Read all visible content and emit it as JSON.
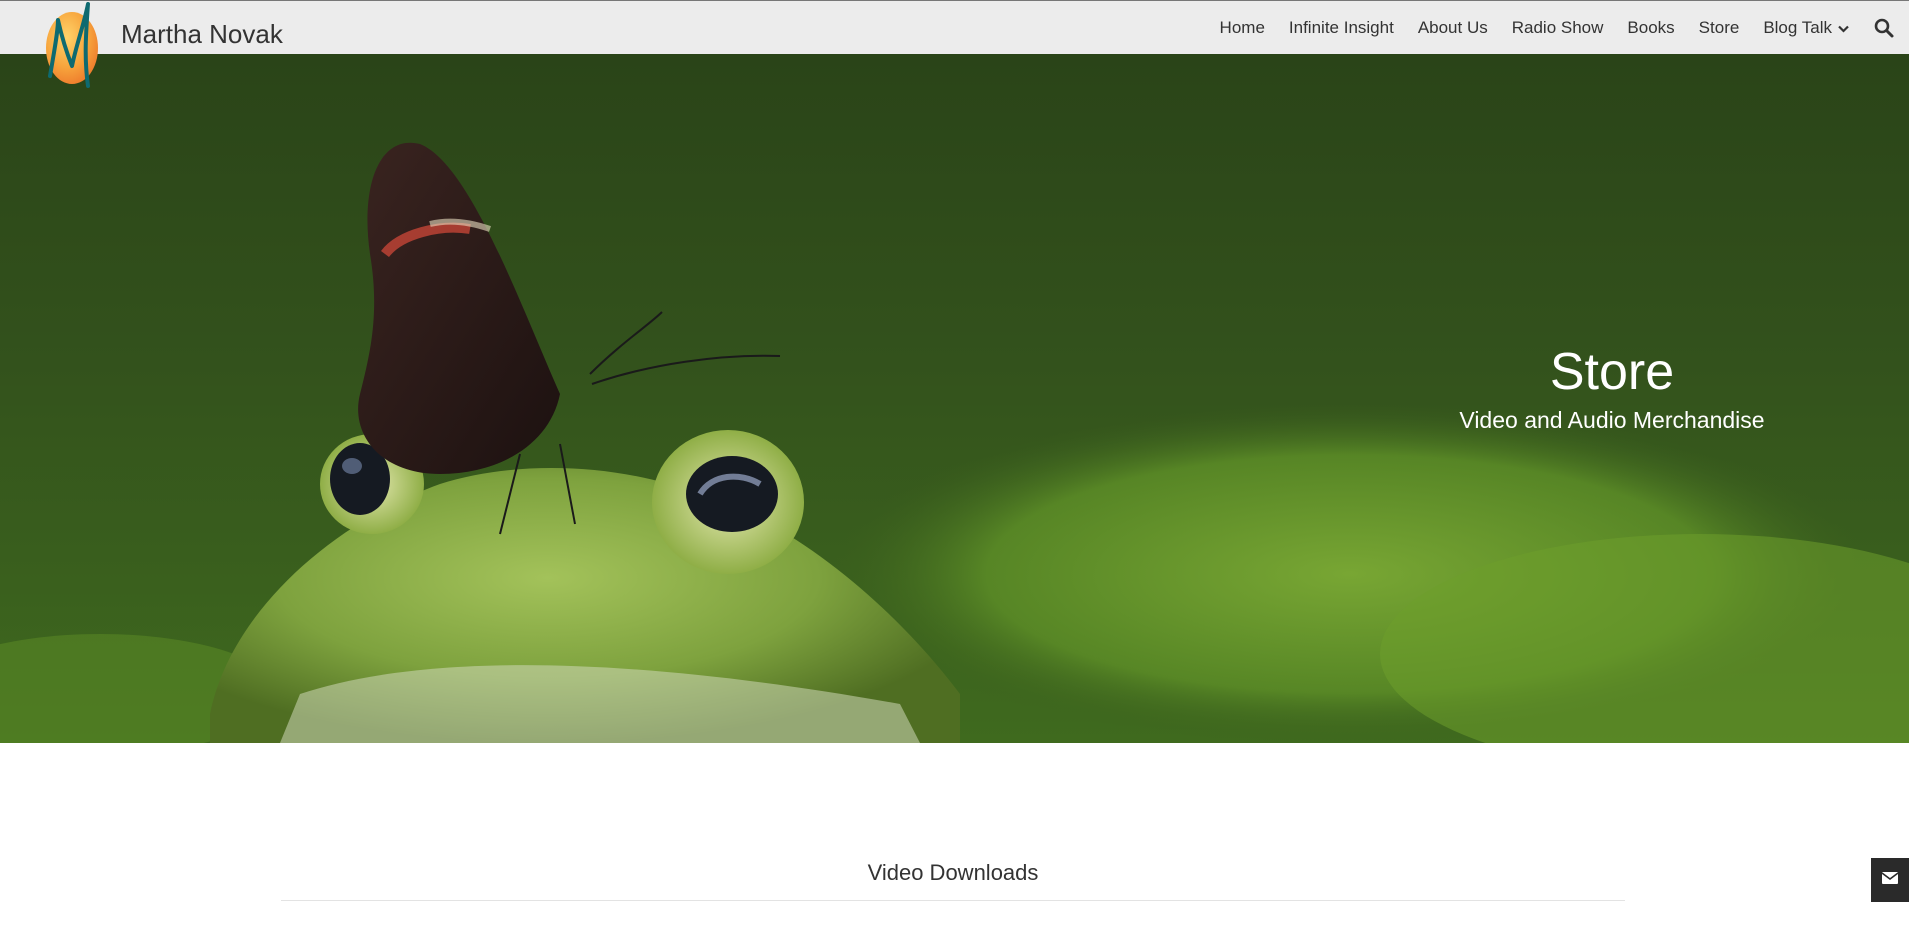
{
  "brand": {
    "name": "Martha Novak",
    "logo_icon": "m-monogram-logo",
    "logo_colors": [
      "#f7a43c",
      "#0e6a70"
    ]
  },
  "nav": {
    "items": [
      {
        "label": "Home"
      },
      {
        "label": "Infinite Insight"
      },
      {
        "label": "About Us"
      },
      {
        "label": "Radio Show"
      },
      {
        "label": "Books"
      },
      {
        "label": "Store"
      },
      {
        "label": "Blog Talk",
        "dropdown": true
      }
    ],
    "search_icon": "search-icon"
  },
  "hero": {
    "title": "Store",
    "subtitle": "Video and Audio Merchandise",
    "image": "frog-with-butterfly-photo"
  },
  "section": {
    "title": "Video Downloads"
  },
  "contact_tab": {
    "icon": "envelope-icon"
  },
  "colors": {
    "header_bg": "#ececec",
    "hero_dark_green": "#2d4a1a",
    "hero_light_green": "#6a9a2e",
    "text": "#333333"
  }
}
